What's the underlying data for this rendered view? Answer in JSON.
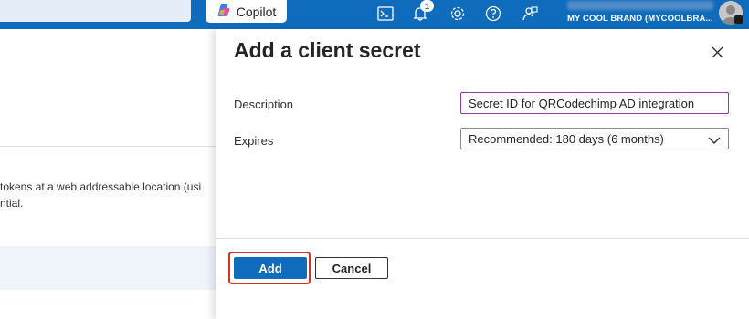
{
  "topbar": {
    "copilot_label": "Copilot",
    "notification_count": "1",
    "account_name": "MY COOL BRAND (MYCOOLBRA...",
    "icons": [
      "cloud-shell-icon",
      "bell-icon",
      "gear-icon",
      "help-icon",
      "feedback-icon"
    ]
  },
  "background": {
    "line1": "tokens at a web addressable location (usi",
    "line2": "ntial."
  },
  "panel": {
    "title": "Add a client secret",
    "description_label": "Description",
    "description_value": "Secret ID for QRCodechimp AD integration",
    "expires_label": "Expires",
    "expires_value": "Recommended: 180 days (6 months)",
    "add_label": "Add",
    "cancel_label": "Cancel"
  },
  "colors": {
    "brand": "#0f6cbd",
    "focus_border": "#8c3fa7",
    "highlight": "#d93025"
  }
}
